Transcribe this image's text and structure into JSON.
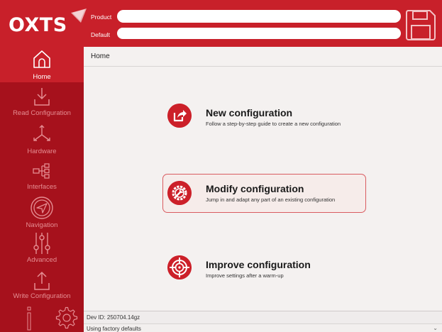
{
  "header": {
    "logo": "OXTS",
    "product_label": "Product",
    "default_label": "Default",
    "product_value": "",
    "default_value": ""
  },
  "sidebar": {
    "items": [
      {
        "label": "Home",
        "icon": "home-icon"
      },
      {
        "label": "Read Configuration",
        "icon": "download-icon"
      },
      {
        "label": "Hardware",
        "icon": "axes-icon"
      },
      {
        "label": "Interfaces",
        "icon": "connector-icon"
      },
      {
        "label": "Navigation",
        "icon": "compass-icon"
      },
      {
        "label": "Advanced",
        "icon": "sliders-icon"
      },
      {
        "label": "Write Configuration",
        "icon": "upload-icon"
      }
    ]
  },
  "breadcrumb": "Home",
  "options": [
    {
      "title": "New configuration",
      "desc": "Follow a step-by-step guide to create a new configuration",
      "icon": "new-config-icon"
    },
    {
      "title": "Modify configuration",
      "desc": "Jump in and adapt any part of an existing configuration",
      "icon": "gear-wrench-icon"
    },
    {
      "title": "Improve configuration",
      "desc": "Improve settings after a warm-up",
      "icon": "target-icon"
    }
  ],
  "status": {
    "dev_id": "Dev ID: 250704.14gz",
    "defaults": "Using factory defaults"
  },
  "colors": {
    "brand_red": "#c8202a",
    "sidebar_red": "#a6111c",
    "inactive_label": "#e58d92"
  }
}
